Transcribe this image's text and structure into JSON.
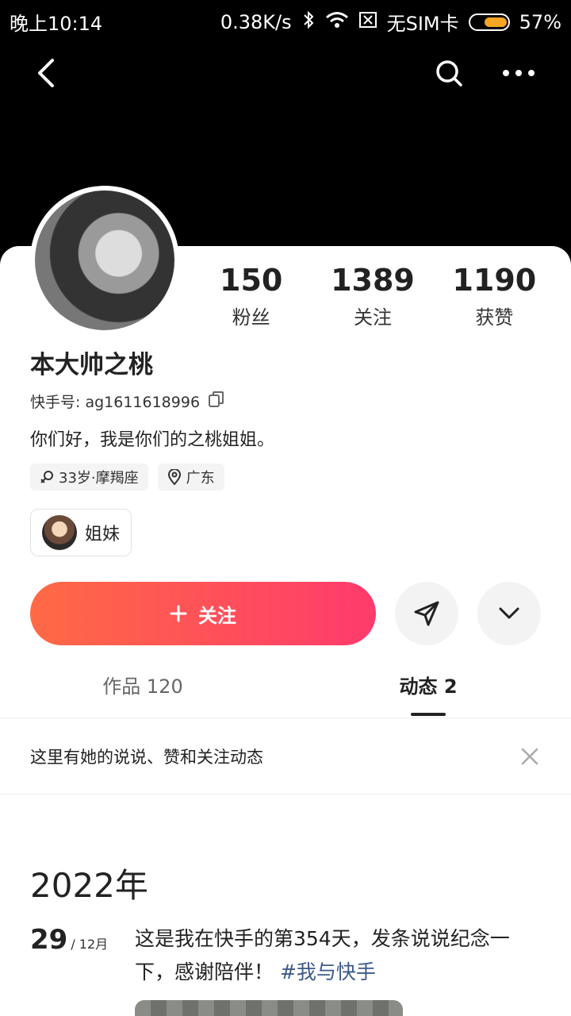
{
  "status_bar": {
    "time": "晚上10:14",
    "network_speed": "0.38K/s",
    "sim": "无SIM卡",
    "battery": "57%"
  },
  "profile": {
    "nickname": "本大帅之桃",
    "kuaishou_id": "快手号: ag1611618996",
    "bio": "你们好，我是你们的之桃姐姐。",
    "tags": [
      "33岁·摩羯座",
      "广东"
    ],
    "group_label": "姐妹"
  },
  "stats": [
    {
      "value": "150",
      "label": "粉丝"
    },
    {
      "value": "1389",
      "label": "关注"
    },
    {
      "value": "1190",
      "label": "获赞"
    }
  ],
  "actions": {
    "follow_label": "关注"
  },
  "tabs": [
    {
      "label": "作品 120",
      "active": false
    },
    {
      "label": "动态 2",
      "active": true
    }
  ],
  "notice": {
    "text": "这里有她的说说、赞和关注动态"
  },
  "feed": {
    "year": "2022年",
    "day": "29",
    "month": "/ 12月",
    "text": "这是我在快手的第354天，发条说说纪念一下，感谢陪伴！",
    "hashtag": "#我与快手"
  },
  "colors": {
    "follow_gradient_start": "#ff6a45",
    "follow_gradient_end": "#ff3a6c",
    "hashtag": "#3d5a8a",
    "battery": "#f5a623"
  }
}
